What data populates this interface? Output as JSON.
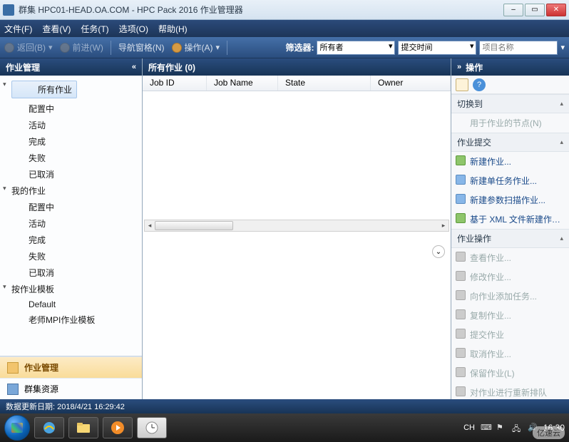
{
  "window": {
    "title": "群集 HPC01-HEAD.OA.COM - HPC Pack 2016 作业管理器"
  },
  "menu": {
    "file": "文件(F)",
    "view": "查看(V)",
    "tasks": "任务(T)",
    "options": "选项(O)",
    "help": "帮助(H)"
  },
  "toolbar": {
    "back": "返回(B)",
    "forward": "前进(W)",
    "nav_pane": "导航窗格(N)",
    "actions": "操作(A)",
    "filter_label": "筛选器:",
    "owner_select": "所有者",
    "time_select": "提交时间",
    "project_placeholder": "项目名称"
  },
  "left": {
    "header": "作业管理",
    "tree": {
      "all_jobs": "所有作业",
      "configuring": "配置中",
      "active": "活动",
      "finished": "完成",
      "failed": "失败",
      "canceled": "已取消",
      "my_jobs": "我的作业",
      "by_template": "按作业模板",
      "tpl_default": "Default",
      "tpl_mpi": "老师MPI作业模板"
    },
    "tab_jobs": "作业管理",
    "tab_cluster": "群集资源"
  },
  "center": {
    "header": "所有作业 (0)",
    "cols": {
      "job_id": "Job ID",
      "job_name": "Job Name",
      "state": "State",
      "owner": "Owner"
    }
  },
  "right": {
    "header": "操作",
    "switch_to": "切换到",
    "nodes_for_job": "用于作业的节点(N)",
    "job_submit": "作业提交",
    "new_job": "新建作业...",
    "new_single": "新建单任务作业...",
    "new_param": "新建参数扫描作业...",
    "new_xml": "基于 XML 文件新建作业...",
    "job_ops": "作业操作",
    "view_job": "查看作业...",
    "modify_job": "修改作业...",
    "add_tasks": "向作业添加任务...",
    "copy_job": "复制作业...",
    "submit_job": "提交作业",
    "cancel_job": "取消作业...",
    "hold_job": "保留作业(L)",
    "requeue": "对作业进行重新排队"
  },
  "status": {
    "text": "数据更新日期: 2018/4/21 16:29:42"
  },
  "tray": {
    "ime": "CH",
    "clock": "16:30"
  },
  "watermark": "亿速云"
}
